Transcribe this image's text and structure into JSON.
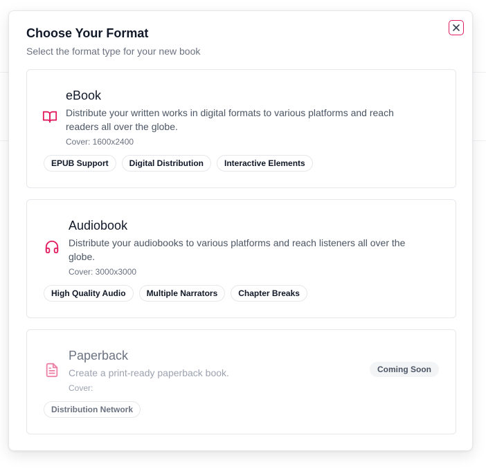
{
  "modal": {
    "title": "Choose Your Format",
    "subtitle": "Select the format type for your new book",
    "close_icon": "x-icon",
    "accent_color": "#e11d5e"
  },
  "formats": [
    {
      "title": "eBook",
      "icon": "book-open-icon",
      "description": "Distribute your written works in digital formats to various platforms and reach readers all over the globe.",
      "cover": "Cover: 1600x2400",
      "tags": [
        "EPUB Support",
        "Digital Distribution",
        "Interactive Elements"
      ],
      "enabled": true
    },
    {
      "title": "Audiobook",
      "icon": "headphones-icon",
      "description": "Distribute your audiobooks to various platforms and reach listeners all over the globe.",
      "cover": "Cover: 3000x3000",
      "tags": [
        "High Quality Audio",
        "Multiple Narrators",
        "Chapter Breaks"
      ],
      "enabled": true
    },
    {
      "title": "Paperback",
      "icon": "file-text-icon",
      "description": "Create a print-ready paperback book.",
      "cover": "Cover:",
      "tags": [
        "Distribution Network"
      ],
      "badge": "Coming Soon",
      "enabled": false
    }
  ]
}
